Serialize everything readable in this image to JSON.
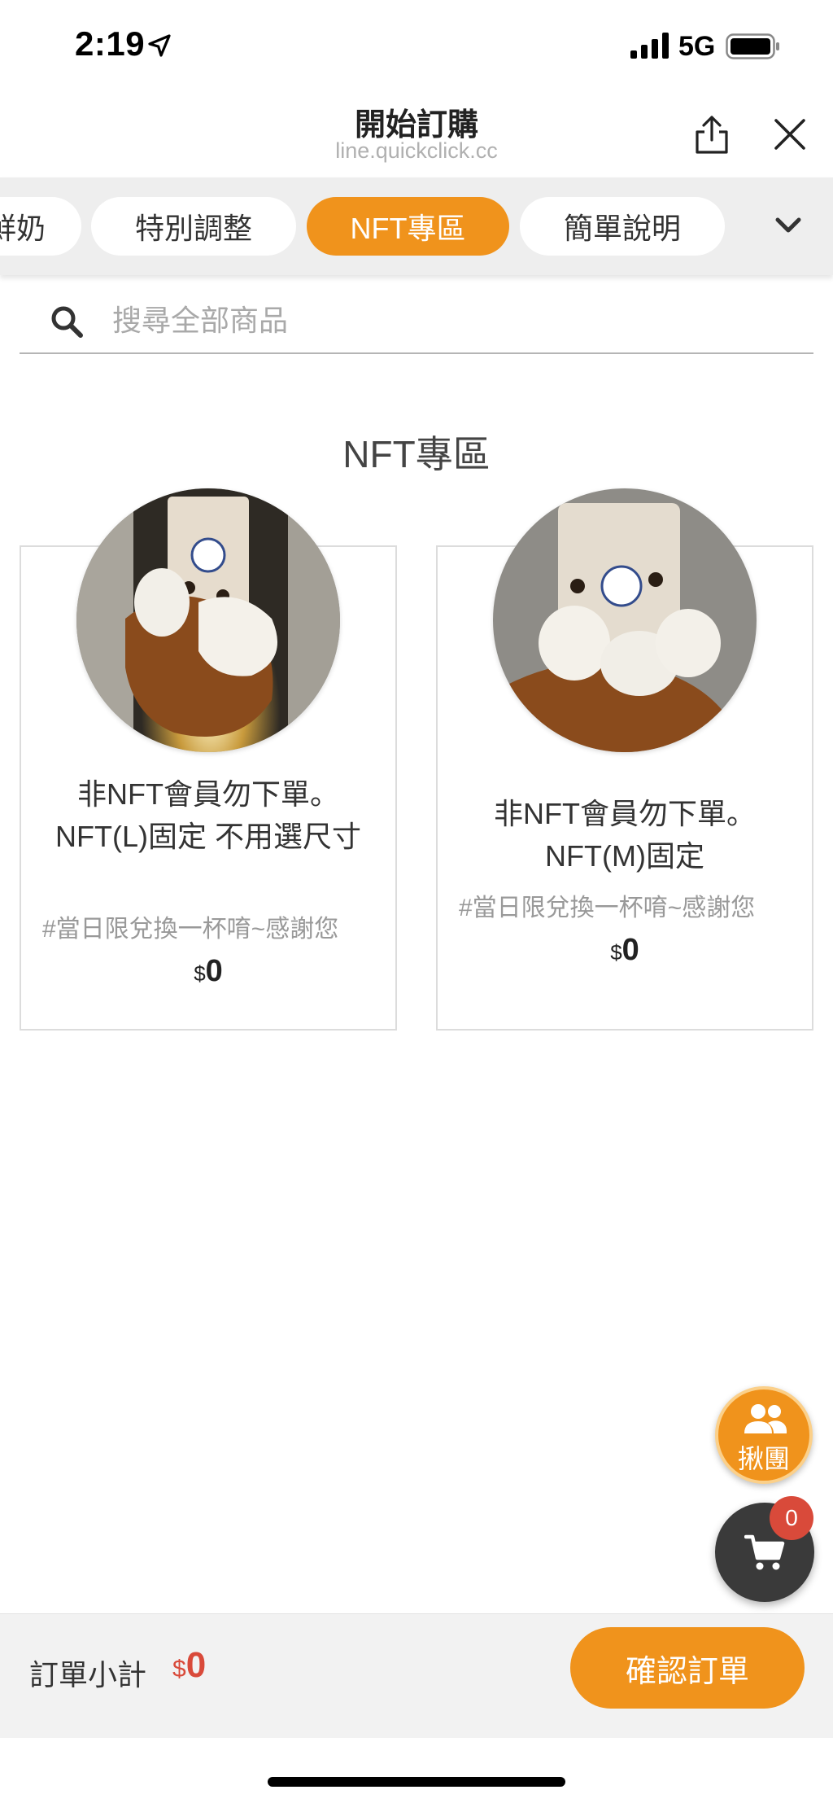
{
  "status_bar": {
    "time": "2:19",
    "network": "5G"
  },
  "header": {
    "title": "開始訂購",
    "url": "line.quickclick.cc"
  },
  "tabs": [
    {
      "label": "鮮奶",
      "active": false
    },
    {
      "label": "特別調整",
      "active": false
    },
    {
      "label": "NFT專區",
      "active": true
    },
    {
      "label": "簡單說明",
      "active": false
    }
  ],
  "search": {
    "placeholder": "搜尋全部商品",
    "value": ""
  },
  "section": {
    "title": "NFT專區"
  },
  "products": [
    {
      "name": "非NFT會員勿下單。NFT(L)固定 不用選尺寸",
      "tag": "#當日限兌換一杯唷~感謝您",
      "currency": "$",
      "price": "0"
    },
    {
      "name": "非NFT會員勿下單。NFT(M)固定",
      "tag": "#當日限兌換一杯唷~感謝您",
      "currency": "$",
      "price": "0"
    }
  ],
  "group_button": {
    "label": "揪團"
  },
  "cart": {
    "count": "0"
  },
  "footer": {
    "subtotal_label": "訂單小計",
    "currency": "$",
    "subtotal": "0",
    "confirm_label": "確認訂單"
  },
  "colors": {
    "accent": "#f0931c",
    "price_red": "#d94a3a",
    "cart_dark": "#3a3a3a"
  },
  "icons": [
    "location-arrow-icon",
    "signal-icon",
    "battery-icon",
    "share-icon",
    "close-icon",
    "chevron-down-icon",
    "search-icon",
    "group-icon",
    "cart-icon"
  ]
}
